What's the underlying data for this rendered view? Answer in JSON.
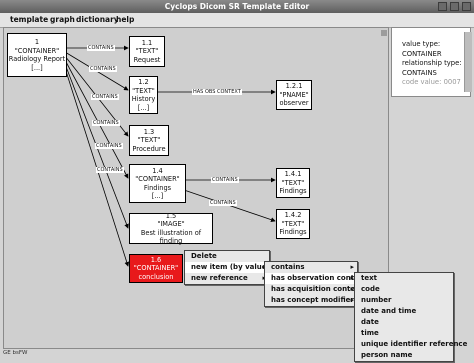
{
  "window": {
    "title": "Cyclops Dicom SR Template Editor"
  },
  "menubar": [
    "template",
    "graph",
    "dictionary",
    "help"
  ],
  "nodes": {
    "n1": {
      "lines": [
        "1",
        "\"CONTAINER\"",
        "Radiology Report",
        "[...]"
      ]
    },
    "n11": {
      "lines": [
        "1.1",
        "\"TEXT\"",
        "Request"
      ]
    },
    "n12": {
      "lines": [
        "1.2",
        "\"TEXT\"",
        "History",
        "[...]"
      ]
    },
    "n121": {
      "lines": [
        "1.2.1",
        "\"PNAME\"",
        "observer"
      ]
    },
    "n13": {
      "lines": [
        "1.3",
        "\"TEXT\"",
        "Procedure"
      ]
    },
    "n14": {
      "lines": [
        "1.4",
        "\"CONTAINER\"",
        "Findings",
        "[...]"
      ]
    },
    "n141": {
      "lines": [
        "1.4.1",
        "\"TEXT\"",
        "Findings"
      ]
    },
    "n142": {
      "lines": [
        "1.4.2",
        "\"TEXT\"",
        "Findings"
      ]
    },
    "n15": {
      "lines": [
        "1.5",
        "\"IMAGE\"",
        "Best illustration of finding"
      ]
    },
    "n16": {
      "lines": [
        "1.6",
        "\"CONTAINER\"",
        "conclusion"
      ]
    }
  },
  "edges": {
    "e11": "CONTAINS",
    "e12": "CONTAINS",
    "e121": "HAS OBS CONTEXT",
    "e13": "CONTAINS",
    "e14": "CONTAINS",
    "e141": "CONTAINS",
    "e142": "CONTAINS",
    "e15": "CONTAINS",
    "e16": "CONTAINS"
  },
  "right_panel": {
    "lines": [
      "value type:",
      "CONTAINER",
      "relationship type:",
      "CONTAINS"
    ],
    "cut": "code value: 0007"
  },
  "status": "GE bsFW",
  "context_menu": [
    "Delete",
    "new item (by value)",
    "new reference"
  ],
  "relation_menu": [
    "contains",
    "has observation context",
    "has acquisition context",
    "has concept modifier"
  ],
  "type_menu": [
    "text",
    "code",
    "number",
    "date and time",
    "date",
    "time",
    "unique identifier reference",
    "person name"
  ]
}
